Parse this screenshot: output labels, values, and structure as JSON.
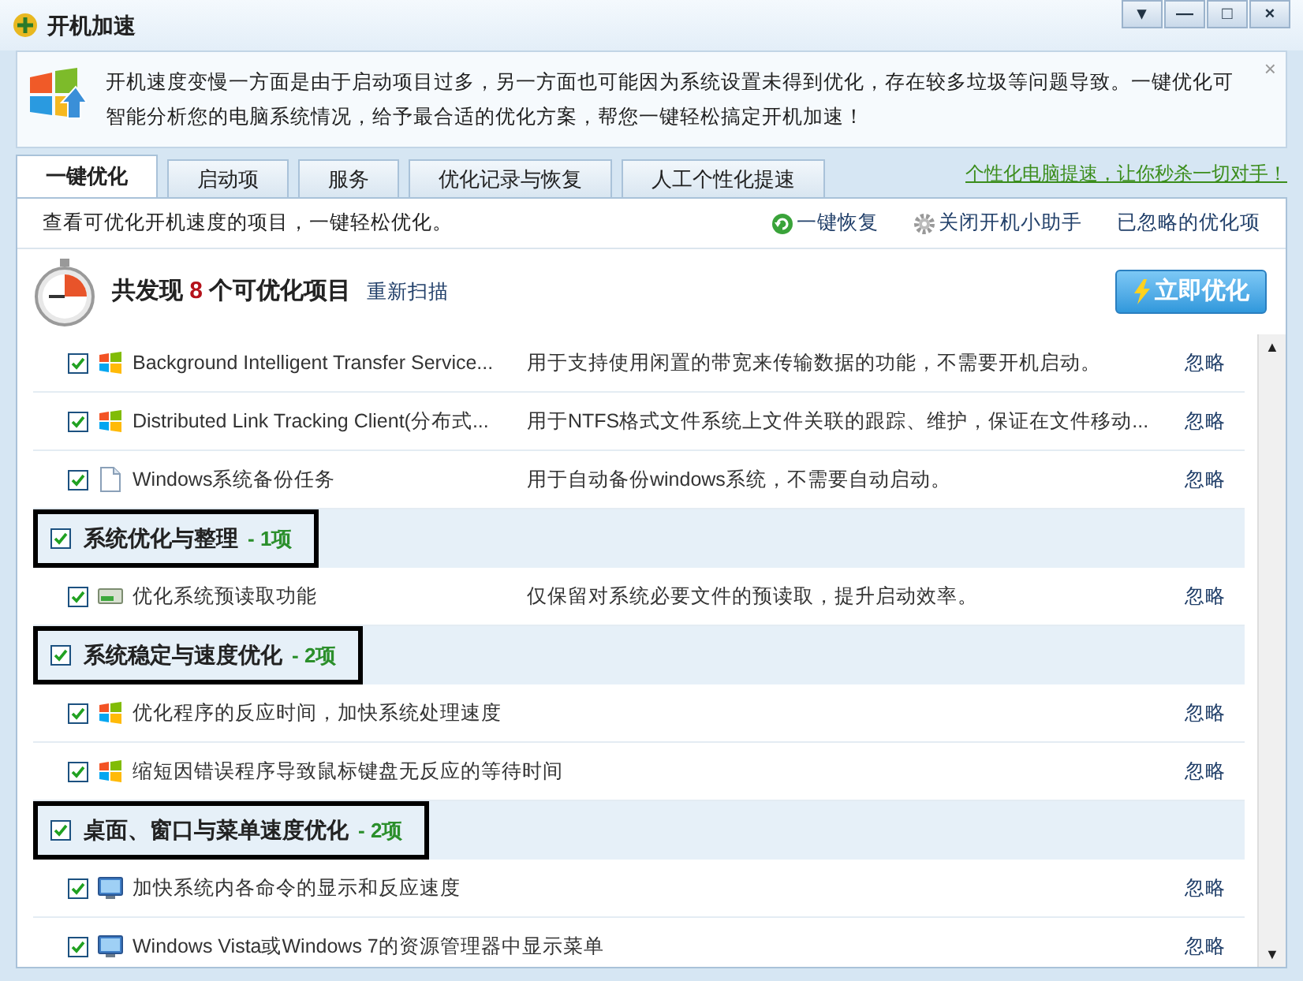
{
  "window": {
    "title": "开机加速",
    "controls": [
      "▾",
      "—",
      "□",
      "×"
    ]
  },
  "info": {
    "text": "开机速度变慢一方面是由于启动项目过多，另一方面也可能因为系统设置未得到优化，存在较多垃圾等问题导致。一键优化可智能分析您的电脑系统情况，给予最合适的优化方案，帮您一键轻松搞定开机加速！",
    "close": "×"
  },
  "tabs": [
    {
      "label": "一键优化",
      "selected": true
    },
    {
      "label": "启动项",
      "selected": false
    },
    {
      "label": "服务",
      "selected": false
    },
    {
      "label": "优化记录与恢复",
      "selected": false
    },
    {
      "label": "人工个性化提速",
      "selected": false
    }
  ],
  "tab_link": "个性化电脑提速，让你秒杀一切对手！",
  "toolbar": {
    "hint": "查看可优化开机速度的项目，一键轻松优化。",
    "actions": [
      "一键恢复",
      "关闭开机小助手",
      "已忽略的优化项"
    ]
  },
  "summary": {
    "prefix": "共发现",
    "count": "8",
    "suffix": "个可优化项目",
    "rescan": "重新扫描",
    "button": "立即优化"
  },
  "rows": [
    {
      "kind": "service",
      "checked": true,
      "name": "Background Intelligent Transfer Service...",
      "desc": "用于支持使用闲置的带宽来传输数据的功能，不需要开机启动。",
      "action": "忽略"
    },
    {
      "kind": "service",
      "checked": true,
      "name": "Distributed Link Tracking Client(分布式...",
      "desc": "用于NTFS格式文件系统上文件关联的跟踪、维护，保证在文件移动...",
      "action": "忽略"
    },
    {
      "kind": "task",
      "checked": true,
      "name": "Windows系统备份任务",
      "desc": "用于自动备份windows系统，不需要自动启动。",
      "action": "忽略"
    },
    {
      "kind": "group",
      "checked": true,
      "annotated": true,
      "name": "系统优化与整理",
      "count": "- 1项"
    },
    {
      "kind": "prefetch",
      "checked": true,
      "name": "优化系统预读取功能",
      "desc": "仅保留对系统必要文件的预读取，提升启动效率。",
      "action": "忽略"
    },
    {
      "kind": "group",
      "checked": true,
      "annotated": true,
      "name": "系统稳定与速度优化",
      "count": "- 2项"
    },
    {
      "kind": "service",
      "checked": true,
      "name": "优化程序的反应时间，加快系统处理速度",
      "action": "忽略"
    },
    {
      "kind": "service",
      "checked": true,
      "name": "缩短因错误程序导致鼠标键盘无反应的等待时间",
      "action": "忽略"
    },
    {
      "kind": "group",
      "checked": true,
      "annotated": true,
      "name": "桌面、窗口与菜单速度优化",
      "count": "- 2项"
    },
    {
      "kind": "display",
      "checked": true,
      "name": "加快系统内各命令的显示和反应速度",
      "action": "忽略"
    },
    {
      "kind": "display",
      "checked": true,
      "name": "Windows Vista或Windows 7的资源管理器中显示菜单",
      "action": "忽略"
    }
  ],
  "scrollbar": {
    "up": "▲",
    "down": "▼"
  }
}
